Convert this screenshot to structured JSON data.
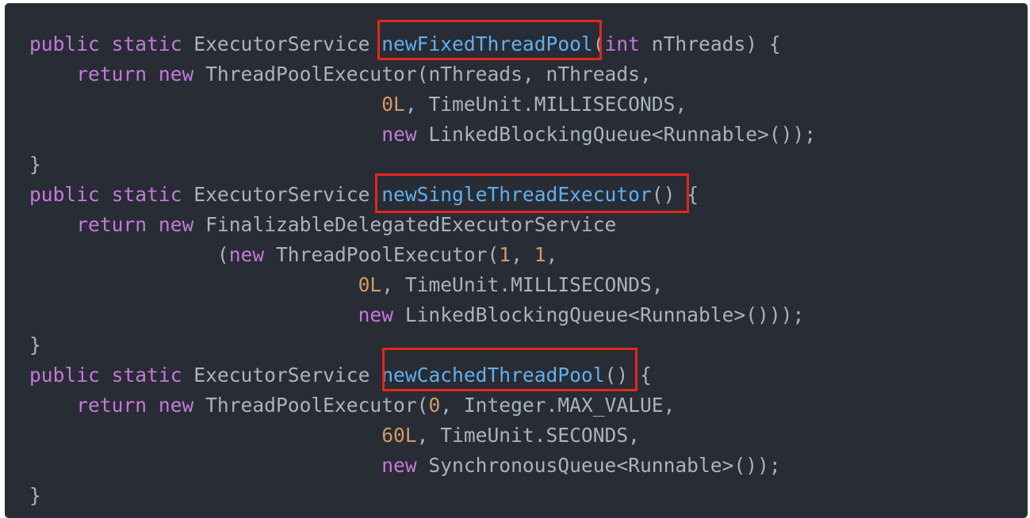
{
  "code": {
    "lines": [
      [
        {
          "t": "public",
          "c": "kw"
        },
        {
          "t": " "
        },
        {
          "t": "static",
          "c": "kw"
        },
        {
          "t": " ExecutorService ",
          "c": "ty"
        },
        {
          "t": "newFixedThreadPool",
          "c": "fn"
        },
        {
          "t": "(",
          "c": "p"
        },
        {
          "t": "int",
          "c": "kw"
        },
        {
          "t": " nThreads) {",
          "c": "p"
        }
      ],
      [
        {
          "t": "    "
        },
        {
          "t": "return",
          "c": "kw"
        },
        {
          "t": " "
        },
        {
          "t": "new",
          "c": "kw"
        },
        {
          "t": " ThreadPoolExecutor(nThreads, nThreads,",
          "c": "p"
        }
      ],
      [
        {
          "t": "                              "
        },
        {
          "t": "0L",
          "c": "num"
        },
        {
          "t": ", TimeUnit.MILLISECONDS,",
          "c": "p"
        }
      ],
      [
        {
          "t": "                              "
        },
        {
          "t": "new",
          "c": "kw"
        },
        {
          "t": " LinkedBlockingQueue<Runnable>());",
          "c": "p"
        }
      ],
      [
        {
          "t": "}",
          "c": "p"
        }
      ],
      [
        {
          "t": "public",
          "c": "kw"
        },
        {
          "t": " "
        },
        {
          "t": "static",
          "c": "kw"
        },
        {
          "t": " ExecutorService ",
          "c": "ty"
        },
        {
          "t": "newSingleThreadExecutor",
          "c": "fn"
        },
        {
          "t": "() {",
          "c": "p"
        }
      ],
      [
        {
          "t": "    "
        },
        {
          "t": "return",
          "c": "kw"
        },
        {
          "t": " "
        },
        {
          "t": "new",
          "c": "kw"
        },
        {
          "t": " FinalizableDelegatedExecutorService",
          "c": "p"
        }
      ],
      [
        {
          "t": "                "
        },
        {
          "t": "(",
          "c": "p"
        },
        {
          "t": "new",
          "c": "kw"
        },
        {
          "t": " ThreadPoolExecutor(",
          "c": "p"
        },
        {
          "t": "1",
          "c": "num"
        },
        {
          "t": ", ",
          "c": "p"
        },
        {
          "t": "1",
          "c": "num"
        },
        {
          "t": ",",
          "c": "p"
        }
      ],
      [
        {
          "t": "                            "
        },
        {
          "t": "0L",
          "c": "num"
        },
        {
          "t": ", TimeUnit.MILLISECONDS,",
          "c": "p"
        }
      ],
      [
        {
          "t": "                            "
        },
        {
          "t": "new",
          "c": "kw"
        },
        {
          "t": " LinkedBlockingQueue<Runnable>()));",
          "c": "p"
        }
      ],
      [
        {
          "t": "}",
          "c": "p"
        }
      ],
      [
        {
          "t": "public",
          "c": "kw"
        },
        {
          "t": " "
        },
        {
          "t": "static",
          "c": "kw"
        },
        {
          "t": " ExecutorService ",
          "c": "ty"
        },
        {
          "t": "newCachedThreadPool",
          "c": "fn"
        },
        {
          "t": "() {",
          "c": "p"
        }
      ],
      [
        {
          "t": "    "
        },
        {
          "t": "return",
          "c": "kw"
        },
        {
          "t": " "
        },
        {
          "t": "new",
          "c": "kw"
        },
        {
          "t": " ThreadPoolExecutor(",
          "c": "p"
        },
        {
          "t": "0",
          "c": "num"
        },
        {
          "t": ", Integer.MAX_VALUE,",
          "c": "p"
        }
      ],
      [
        {
          "t": "                              "
        },
        {
          "t": "60L",
          "c": "num"
        },
        {
          "t": ", TimeUnit.SECONDS,",
          "c": "p"
        }
      ],
      [
        {
          "t": "                              "
        },
        {
          "t": "new",
          "c": "kw"
        },
        {
          "t": " SynchronousQueue<Runnable>());",
          "c": "p"
        }
      ],
      [
        {
          "t": "}",
          "c": "p"
        }
      ]
    ]
  },
  "colors": {
    "background": "#282c34",
    "keyword": "#c678dd",
    "function": "#61afef",
    "number": "#d19a66",
    "plain": "#abb2bf",
    "highlight_box": "#e3261c"
  }
}
